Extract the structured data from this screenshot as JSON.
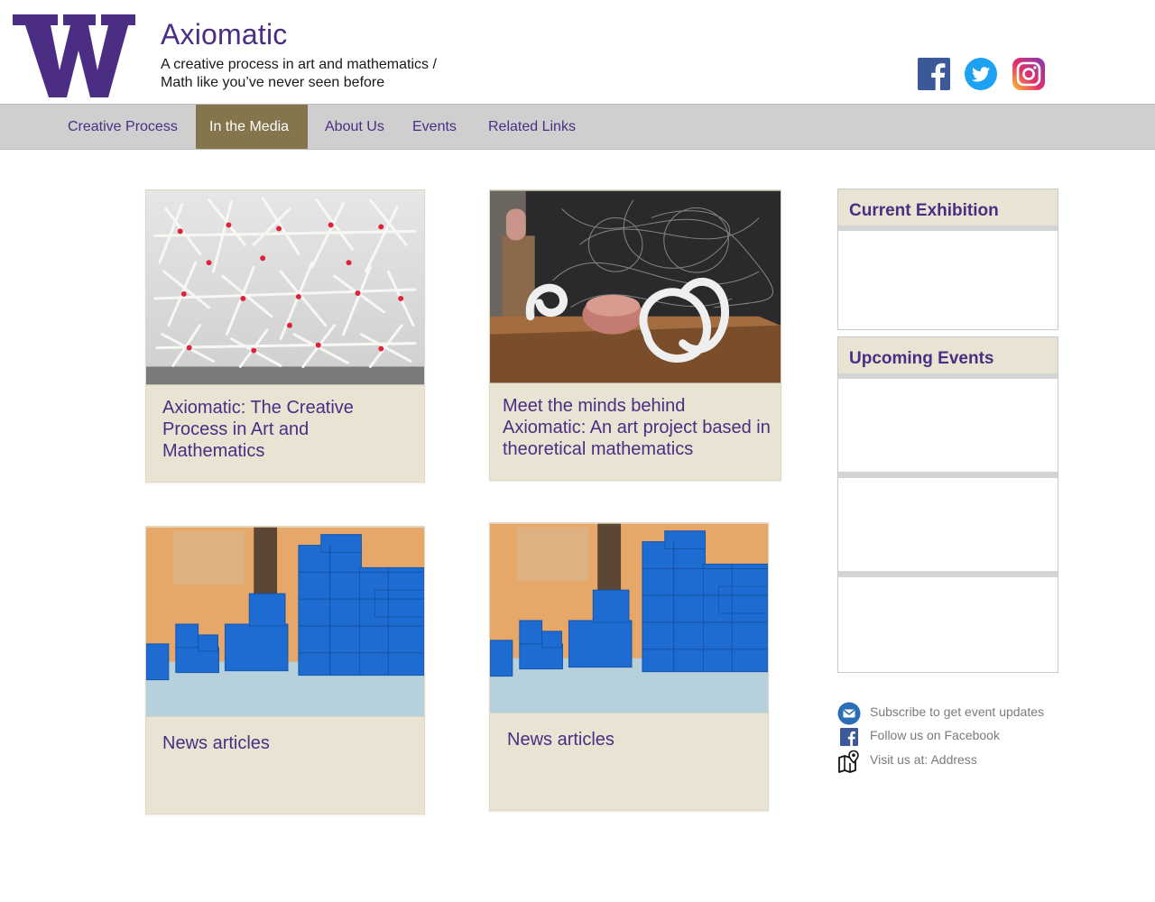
{
  "header": {
    "site_title": "Axiomatic",
    "tagline_line1": "A creative process in art and mathematics /",
    "tagline_line2": "Math like you’ve never seen before",
    "logo_letter": "W"
  },
  "social": [
    {
      "name": "facebook-icon"
    },
    {
      "name": "twitter-icon"
    },
    {
      "name": "instagram-icon"
    }
  ],
  "nav": {
    "items": [
      {
        "label": "Creative Process",
        "active": false
      },
      {
        "label": "In the Media",
        "active": true
      },
      {
        "label": "About Us",
        "active": false
      },
      {
        "label": "Events",
        "active": false
      },
      {
        "label": "Related Links",
        "active": false
      }
    ]
  },
  "cards": [
    {
      "caption": "Axiomatic: The Creative Process in Art and Mathematics"
    },
    {
      "caption": "Meet the minds behind Axiomatic: An art project based in theoretical mathematics"
    },
    {
      "caption": "News articles"
    },
    {
      "caption": "News articles"
    }
  ],
  "sidebar": {
    "current_exhibition_title": "Current Exhibition",
    "upcoming_events_title": "Upcoming Events"
  },
  "contact": {
    "subscribe": "Subscribe to get event updates",
    "follow": "Follow us on Facebook",
    "visit": "Visit us at: Address"
  },
  "colors": {
    "brand_purple": "#4b2e83",
    "gold_active": "#85754d",
    "card_bg": "#e8e3d3",
    "nav_bg": "#cfcfcf"
  }
}
